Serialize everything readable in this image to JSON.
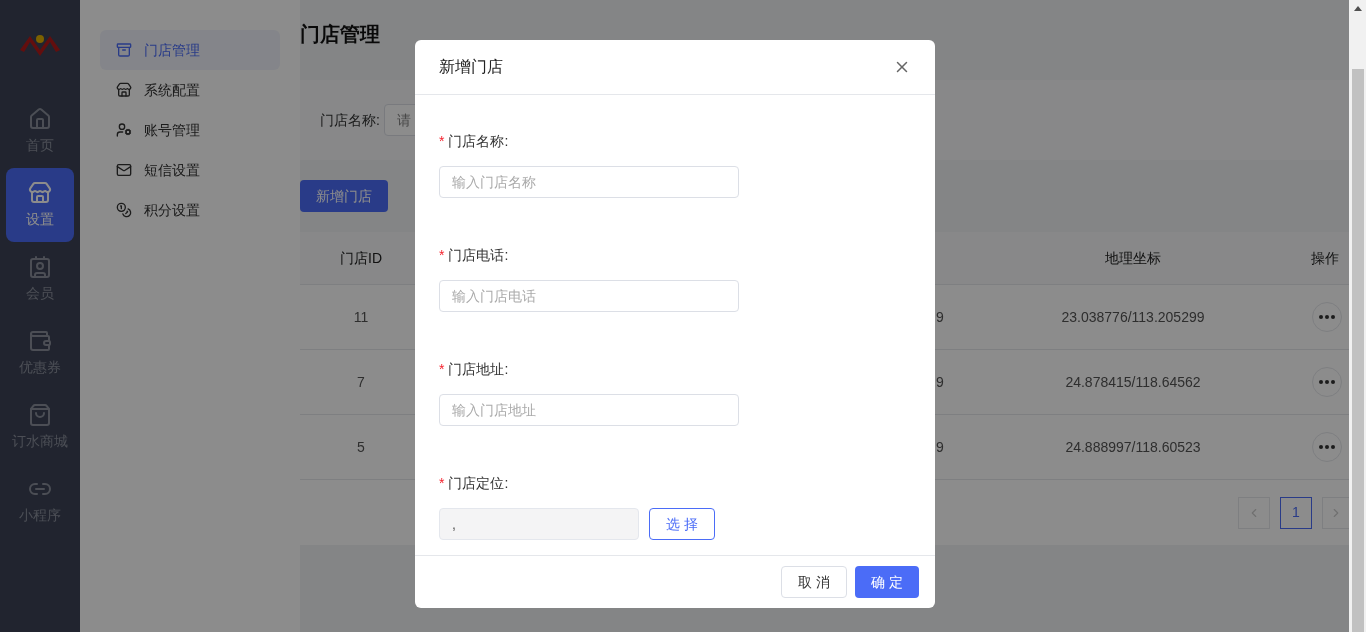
{
  "nav": {
    "items": [
      {
        "label": "首页",
        "selected": false
      },
      {
        "label": "设置",
        "selected": true
      },
      {
        "label": "会员",
        "selected": false
      },
      {
        "label": "优惠券",
        "selected": false
      },
      {
        "label": "订水商城",
        "selected": false
      },
      {
        "label": "小程序",
        "selected": false
      }
    ]
  },
  "submenu": {
    "items": [
      {
        "label": "门店管理",
        "selected": true
      },
      {
        "label": "系统配置",
        "selected": false
      },
      {
        "label": "账号管理",
        "selected": false
      },
      {
        "label": "短信设置",
        "selected": false
      },
      {
        "label": "积分设置",
        "selected": false
      }
    ]
  },
  "page": {
    "title": "门店管理",
    "search": {
      "label": "门店名称:",
      "placeholder": "请"
    },
    "add_button": "新增门店",
    "table": {
      "columns": [
        "门店ID",
        "地理坐标",
        "操作"
      ],
      "rows": [
        {
          "id": "11",
          "column_3": "9",
          "coords": "23.038776/113.205299"
        },
        {
          "id": "7",
          "column_3": "9",
          "coords": "24.878415/118.64562"
        },
        {
          "id": "5",
          "column_3": "9",
          "coords": "24.888997/118.60523"
        }
      ]
    },
    "pagination": {
      "pages": [
        {
          "label": "1",
          "selected": true
        }
      ]
    }
  },
  "modal": {
    "title": "新增门店",
    "fields": [
      {
        "kind": "input",
        "label": "门店名称:",
        "required_mark": "*",
        "placeholder": "输入门店名称"
      },
      {
        "kind": "input",
        "label": "门店电话:",
        "required_mark": "*",
        "placeholder": "输入门店电话"
      },
      {
        "kind": "input",
        "label": "门店地址:",
        "required_mark": "*",
        "placeholder": "输入门店地址"
      },
      {
        "kind": "location",
        "label": "门店定位:",
        "required_mark": "*",
        "value": ",",
        "button": "选 择"
      }
    ],
    "cancel": "取 消",
    "ok": "确 定"
  }
}
